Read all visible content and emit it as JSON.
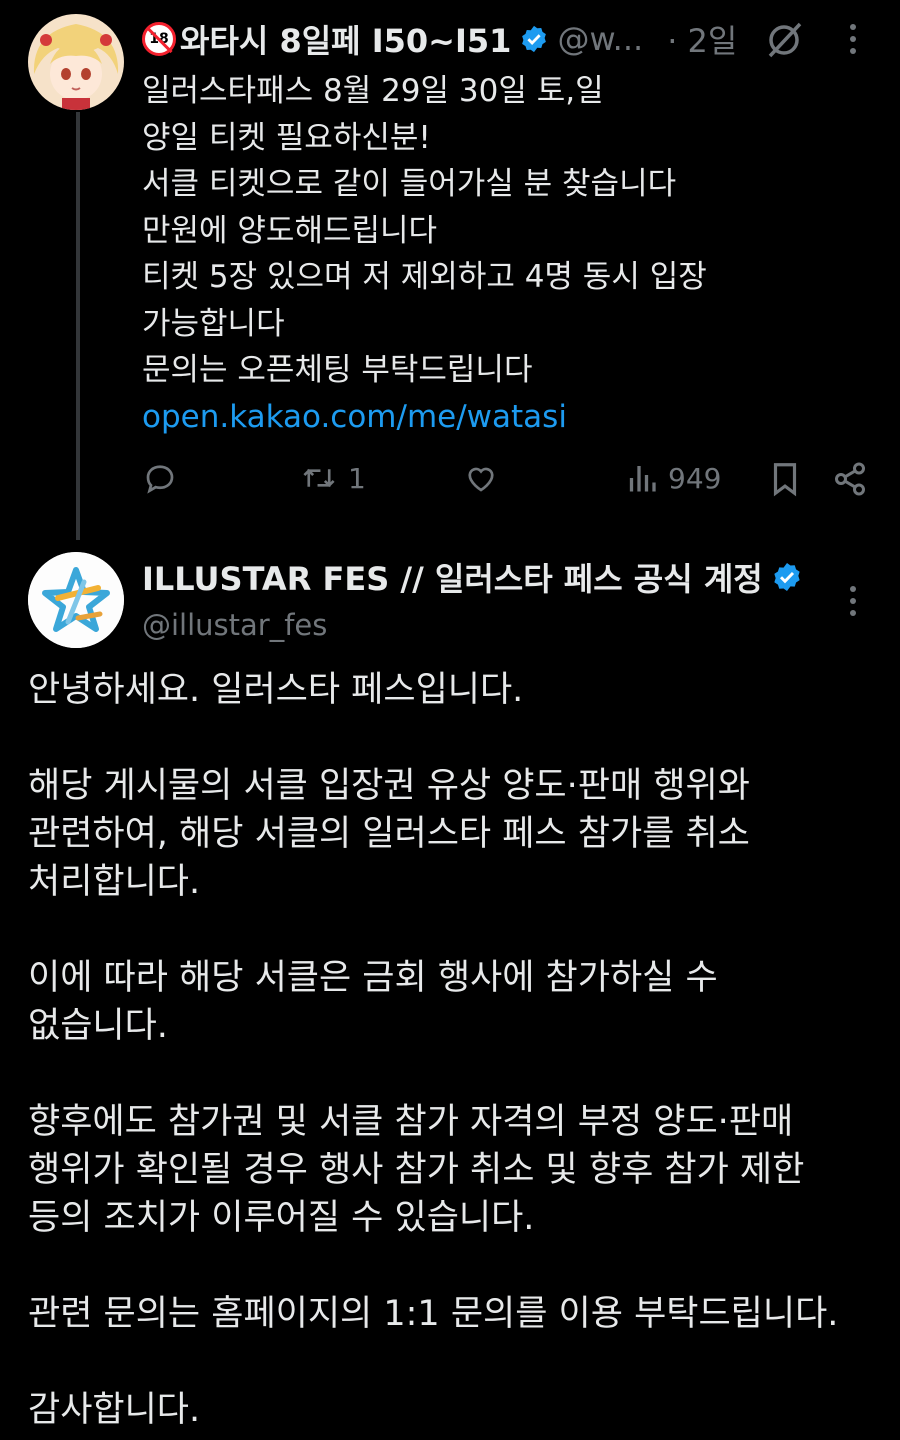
{
  "tweet": {
    "author_name": "와타시 8일페 I50~I51",
    "age_badge": "18",
    "handle": "@w...",
    "time": "· 2일",
    "lines": [
      "일러스타패스 8월 29일 30일 토,일",
      "양일 티켓 필요하신분!",
      "서클 티켓으로 같이 들어가실 분 찾습니다",
      "만원에 양도해드립니다",
      "티켓 5장 있으며 저 제외하고 4명 동시 입장",
      "가능합니다",
      "문의는 오픈체팅 부탁드립니다"
    ],
    "link": "open.kakao.com/me/watasi",
    "retweet_count": "1",
    "view_count": "949"
  },
  "reply": {
    "author_name": "ILLUSTAR FES // 일러스타 페스 공식 계정",
    "handle": "@illustar_fes",
    "paragraphs": [
      [
        "안녕하세요. 일러스타 페스입니다."
      ],
      [
        "해당 게시물의 서클 입장권 유상 양도·판매 행위와",
        "관련하여, 해당 서클의 일러스타 페스 참가를 취소",
        "처리합니다."
      ],
      [
        "이에 따라 해당 서클은 금회 행사에 참가하실 수",
        "없습니다."
      ],
      [
        "향후에도 참가권 및 서클 참가 자격의 부정 양도·판매",
        "행위가 확인될 경우 행사 참가 취소 및 향후 참가 제한",
        "등의 조치가 이루어질 수 있습니다."
      ],
      [
        "관련 문의는 홈페이지의 1:1 문의를 이용 부탁드립니다."
      ],
      [
        "감사합니다."
      ]
    ]
  },
  "colors": {
    "background": "#000000",
    "text": "#e7e9ea",
    "muted": "#71767b",
    "link": "#1d9bf0",
    "verified": "#1d9bf0"
  },
  "icons": [
    "verified-badge-icon",
    "grok-icon",
    "more-icon",
    "reply-icon",
    "retweet-icon",
    "like-icon",
    "views-icon",
    "bookmark-icon",
    "share-icon"
  ]
}
